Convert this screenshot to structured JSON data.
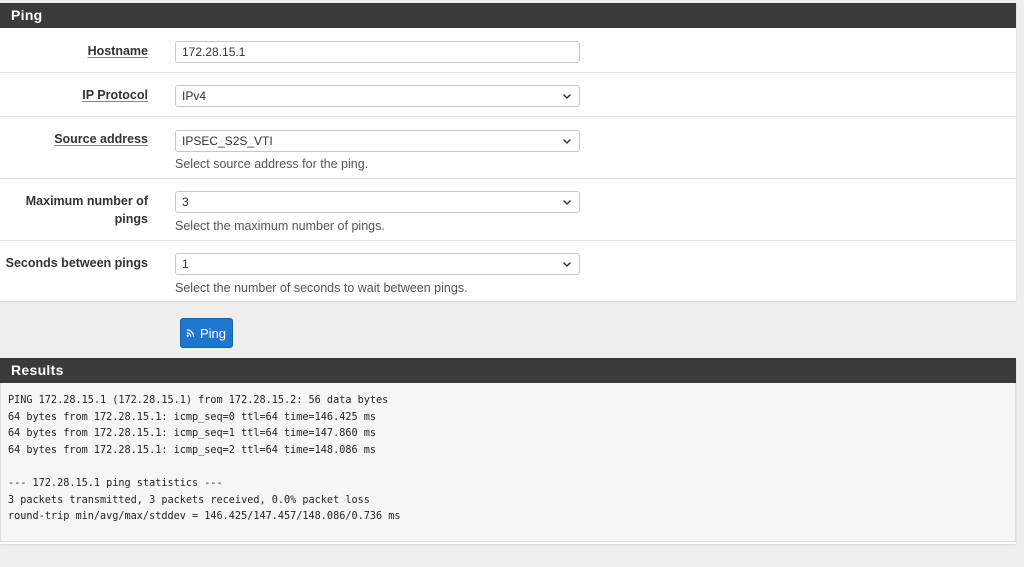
{
  "ping_panel": {
    "title": "Ping",
    "fields": {
      "hostname": {
        "label": "Hostname",
        "value": "172.28.15.1"
      },
      "ip_protocol": {
        "label": "IP Protocol",
        "value": "IPv4"
      },
      "source_address": {
        "label": "Source address",
        "value": "IPSEC_S2S_VTI",
        "help": "Select source address for the ping."
      },
      "max_pings": {
        "label_line1": "Maximum number of",
        "label_line2": "pings",
        "value": "3",
        "help": "Select the maximum number of pings."
      },
      "seconds_between": {
        "label": "Seconds between pings",
        "value": "1",
        "help": "Select the number of seconds to wait between pings."
      }
    },
    "ping_button": {
      "label": "Ping",
      "icon": "rss-icon"
    }
  },
  "results_panel": {
    "title": "Results",
    "lines": [
      "PING 172.28.15.1 (172.28.15.1) from 172.28.15.2: 56 data bytes",
      "64 bytes from 172.28.15.1: icmp_seq=0 ttl=64 time=146.425 ms",
      "64 bytes from 172.28.15.1: icmp_seq=1 ttl=64 time=147.860 ms",
      "64 bytes from 172.28.15.1: icmp_seq=2 ttl=64 time=148.086 ms",
      "",
      "--- 172.28.15.1 ping statistics ---",
      "3 packets transmitted, 3 packets received, 0.0% packet loss",
      "round-trip min/avg/max/stddev = 146.425/147.457/148.086/0.736 ms"
    ]
  },
  "colors": {
    "heading_bg": "#3a3a3a",
    "button_bg": "#1e76cf",
    "page_bg": "#efefef"
  }
}
